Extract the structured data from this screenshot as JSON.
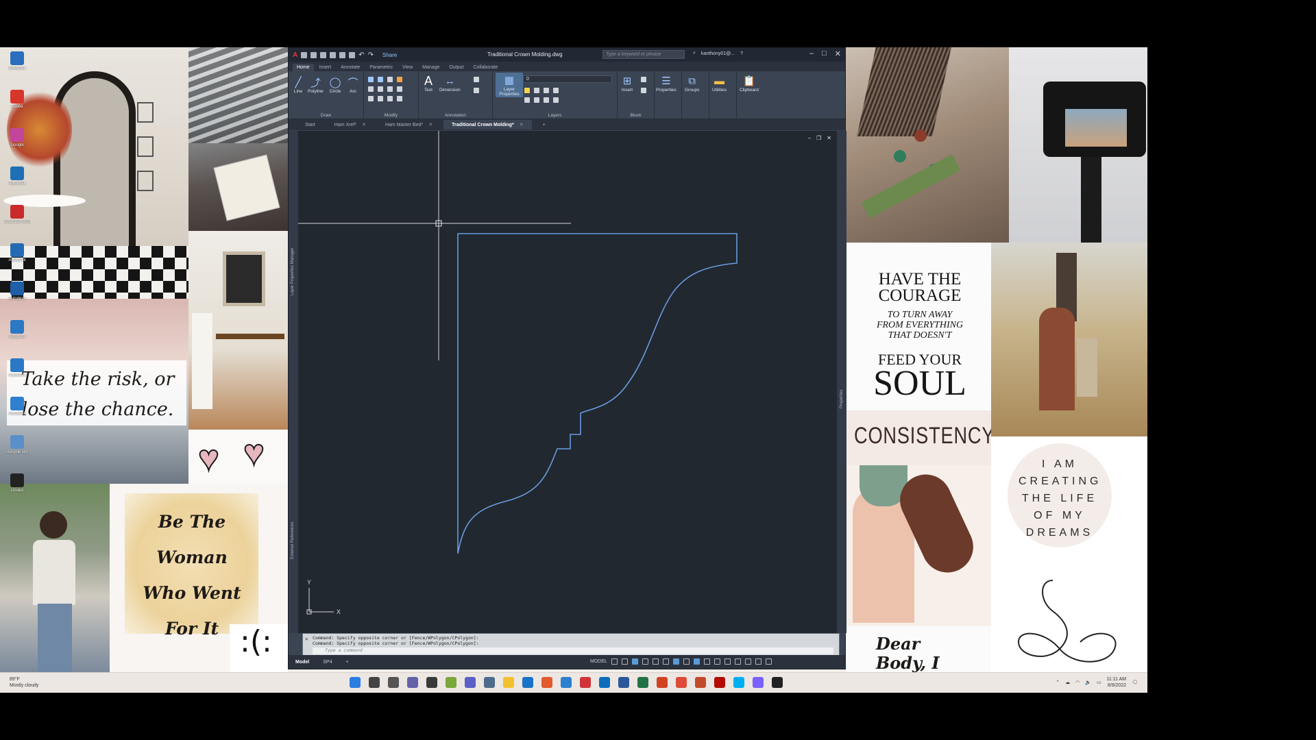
{
  "colors": {
    "cad_background": "#212830",
    "profile_line": "#6a9ce0",
    "ribbon": "#3b4453",
    "taskbar": "#ece7e3"
  },
  "desktop": {
    "icons": [
      {
        "label": "Autodesk",
        "icon": "autodesk-icon",
        "color": "#2a6ebd"
      },
      {
        "label": "Adobe",
        "icon": "adobe-icon",
        "color": "#d9362b"
      },
      {
        "label": "Google",
        "icon": "app-icon",
        "color": "#c2459c"
      },
      {
        "label": "Autodesk",
        "icon": "autodesk-icon",
        "color": "#1f6fb5"
      },
      {
        "label": "AutoCAD 2023",
        "icon": "autocad-icon",
        "color": "#c92a2a"
      },
      {
        "label": "Autodesk",
        "icon": "autodesk-icon",
        "color": "#246bb4"
      },
      {
        "label": "Autodesk",
        "icon": "autodesk-icon",
        "color": "#1e5fa8"
      },
      {
        "label": "Autodesk",
        "icon": "autodesk-icon",
        "color": "#2b78c5"
      },
      {
        "label": "Autodesk",
        "icon": "autodesk-icon",
        "color": "#2b78c5"
      },
      {
        "label": "Autodesk",
        "icon": "autodesk-icon",
        "color": "#2f80cf"
      },
      {
        "label": "Recycle Bin",
        "icon": "recycle-bin-icon",
        "color": "#5b8fc9"
      },
      {
        "label": "Oculus",
        "icon": "oculus-icon",
        "color": "#222222"
      }
    ],
    "quotes": {
      "risk": "Take the risk, or lose the chance.",
      "courage_1": "HAVE THE COURAGE",
      "courage_2": "TO TURN AWAY FROM EVERYTHING THAT DOESN'T",
      "courage_3": "FEED YOUR",
      "courage_4": "SOUL",
      "consistency": "CONSISTENCY",
      "dreams": "I AM CREATING THE LIFE OF MY DREAMS",
      "woman": "Be The Woman Who Went For It",
      "body": "Dear Body, I love you",
      "smiley": ":(:"
    }
  },
  "acad": {
    "title": "Traditional Crown Molding.dwg",
    "share": "Share",
    "search_placeholder": "Type a keyword or phrase",
    "user": "kanthony01@...",
    "ribbon_tabs": [
      "Home",
      "Insert",
      "Annotate",
      "Parametric",
      "View",
      "Manage",
      "Output",
      "Collaborate"
    ],
    "draw_tools": [
      "Line",
      "Polyline",
      "Circle",
      "Arc"
    ],
    "text_tool": "Text",
    "dimension_tool": "Dimension",
    "layer_properties": "Layer Properties",
    "layer_value": "0",
    "insert_tool": "Insert",
    "properties_tool": "Properties",
    "groups_tool": "Groups",
    "utilities_tool": "Utilities",
    "clipboard_tool": "Clipboard",
    "panel_titles": [
      "Draw",
      "Modify",
      "Annotation",
      "Layers",
      "Block"
    ],
    "doc_tabs": [
      "Start",
      "Ham Xref*",
      "Ham Master Bed*",
      "Traditional Crown Molding*"
    ],
    "side_labels": [
      "Layer Properties Manager",
      "External References",
      "Properties"
    ],
    "command_history": [
      "Command: Specify opposite corner or [Fence/WPolygon/CPolygon]:",
      "Command: Specify opposite corner or [Fence/WPolygon/CPolygon]:"
    ],
    "command_placeholder": "Type a command",
    "layout_tabs": [
      "Model",
      "SP4"
    ],
    "model_label": "MODEL",
    "ucs_x": "X",
    "ucs_y": "Y"
  },
  "taskbar": {
    "weather_temp": "89°F",
    "weather_desc": "Mostly cloudy",
    "apps": [
      {
        "icon": "windows-start-icon",
        "color": "#2a7de1"
      },
      {
        "icon": "search-icon",
        "color": "#444444"
      },
      {
        "icon": "task-view-icon",
        "color": "#555555"
      },
      {
        "icon": "chat-icon",
        "color": "#6264a7"
      },
      {
        "icon": "widgets-icon",
        "color": "#3a3a3a"
      },
      {
        "icon": "app-icon",
        "color": "#7aa73c"
      },
      {
        "icon": "teams-icon",
        "color": "#5b5fc7"
      },
      {
        "icon": "calculator-icon",
        "color": "#4f6b8c"
      },
      {
        "icon": "file-explorer-icon",
        "color": "#f2c12e"
      },
      {
        "icon": "mail-icon",
        "color": "#1a73c7"
      },
      {
        "icon": "app-icon",
        "color": "#e25a2e"
      },
      {
        "icon": "app-icon",
        "color": "#2d7fcf"
      },
      {
        "icon": "autocad-icon",
        "color": "#d13438"
      },
      {
        "icon": "outlook-icon",
        "color": "#0f6cbd"
      },
      {
        "icon": "word-icon",
        "color": "#2b579a"
      },
      {
        "icon": "excel-icon",
        "color": "#217346"
      },
      {
        "icon": "powerpoint-icon",
        "color": "#d04423"
      },
      {
        "icon": "chrome-icon",
        "color": "#dd4b39"
      },
      {
        "icon": "app-icon",
        "color": "#c24a2b"
      },
      {
        "icon": "acrobat-icon",
        "color": "#b30b00"
      },
      {
        "icon": "skype-icon",
        "color": "#00aff0"
      },
      {
        "icon": "messenger-icon",
        "color": "#7b61ff"
      },
      {
        "icon": "oculus-icon",
        "color": "#222222"
      }
    ],
    "time": "11:11 AM",
    "date": "8/9/2022"
  }
}
